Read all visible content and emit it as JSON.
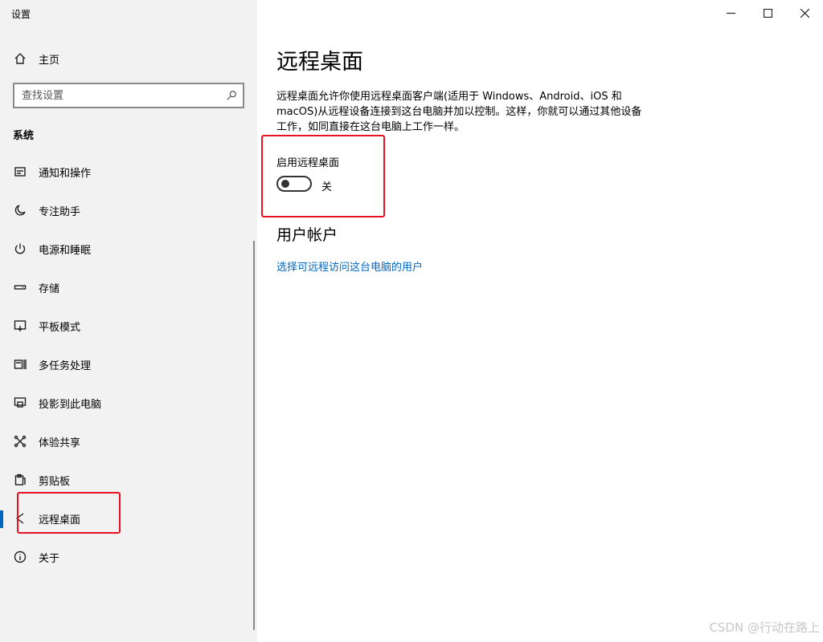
{
  "app": {
    "title": "设置"
  },
  "sidebar": {
    "home_label": "主页",
    "search_placeholder": "查找设置",
    "section_header": "系统",
    "items": [
      {
        "label": "通知和操作",
        "icon": "notification-icon"
      },
      {
        "label": "专注助手",
        "icon": "moon-icon"
      },
      {
        "label": "电源和睡眠",
        "icon": "power-icon"
      },
      {
        "label": "存储",
        "icon": "storage-icon"
      },
      {
        "label": "平板模式",
        "icon": "tablet-mode-icon"
      },
      {
        "label": "多任务处理",
        "icon": "multitasking-icon"
      },
      {
        "label": "投影到此电脑",
        "icon": "projection-icon"
      },
      {
        "label": "体验共享",
        "icon": "shared-experiences-icon"
      },
      {
        "label": "剪贴板",
        "icon": "clipboard-icon"
      },
      {
        "label": "远程桌面",
        "icon": "remote-desktop-icon",
        "active": true
      },
      {
        "label": "关于",
        "icon": "info-icon"
      }
    ]
  },
  "main": {
    "title": "远程桌面",
    "description": "远程桌面允许你使用远程桌面客户端(适用于 Windows、Android、iOS 和 macOS)从远程设备连接到这台电脑并加以控制。这样，你就可以通过其他设备工作，如同直接在这台电脑上工作一样。",
    "toggle_label": "启用远程桌面",
    "toggle_state": "关",
    "toggle_on": false,
    "user_section_title": "用户帐户",
    "user_link": "选择可远程访问这台电脑的用户"
  },
  "colors": {
    "accent": "#0067c0",
    "highlight_box": "#e81123",
    "sidebar_bg": "#f2f2f2"
  },
  "watermark": "CSDN @行动在路上"
}
